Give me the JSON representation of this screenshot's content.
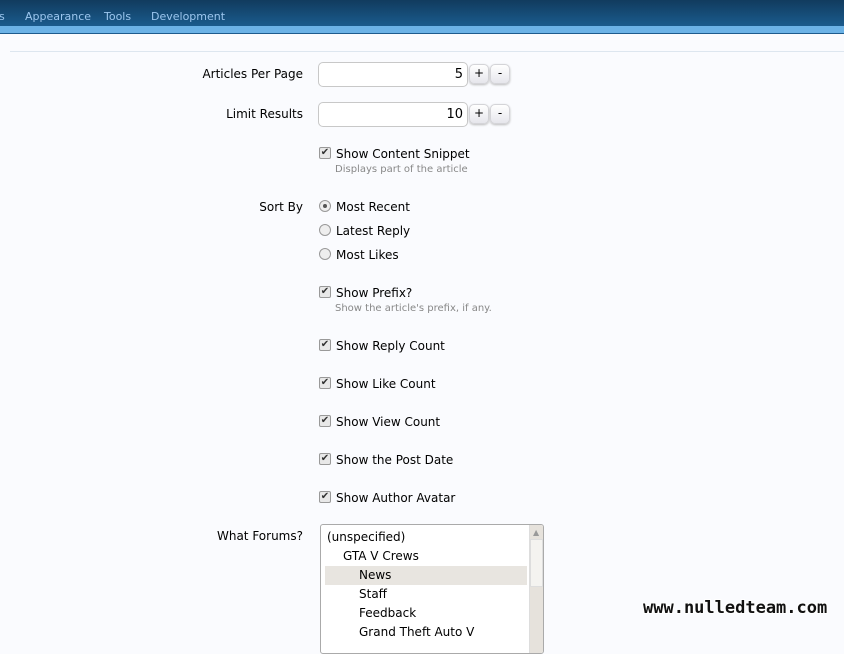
{
  "nav": {
    "items": [
      "s",
      "Appearance",
      "Tools",
      "Development"
    ]
  },
  "form": {
    "articles_per_page": {
      "label": "Articles Per Page",
      "value": "5",
      "plus": "+",
      "minus": "-"
    },
    "limit_results": {
      "label": "Limit Results",
      "value": "10",
      "plus": "+",
      "minus": "-"
    },
    "show_content_snippet": {
      "label": "Show Content Snippet",
      "hint": "Displays part of the article",
      "checked": true
    },
    "sort_by": {
      "label": "Sort By",
      "options": [
        "Most Recent",
        "Latest Reply",
        "Most Likes"
      ],
      "selected": "Most Recent"
    },
    "show_prefix": {
      "label": "Show Prefix?",
      "hint": "Show the article's prefix, if any.",
      "checked": true
    },
    "show_reply_count": {
      "label": "Show Reply Count",
      "checked": true
    },
    "show_like_count": {
      "label": "Show Like Count",
      "checked": true
    },
    "show_view_count": {
      "label": "Show View Count",
      "checked": true
    },
    "show_post_date": {
      "label": "Show the Post Date",
      "checked": true
    },
    "show_author_avatar": {
      "label": "Show Author Avatar",
      "checked": true
    },
    "what_forums": {
      "label": "What Forums?",
      "options": [
        "(unspecified)",
        "GTA V Crews",
        "News",
        "Staff",
        "Feedback",
        "Grand Theft Auto V"
      ],
      "selected": "News"
    }
  },
  "watermark": "www.nulledteam.com",
  "colors": {
    "nav": "#1a5b8d",
    "nav_strip": "#6bb2e6",
    "selected_option": "#e8e5e0"
  }
}
